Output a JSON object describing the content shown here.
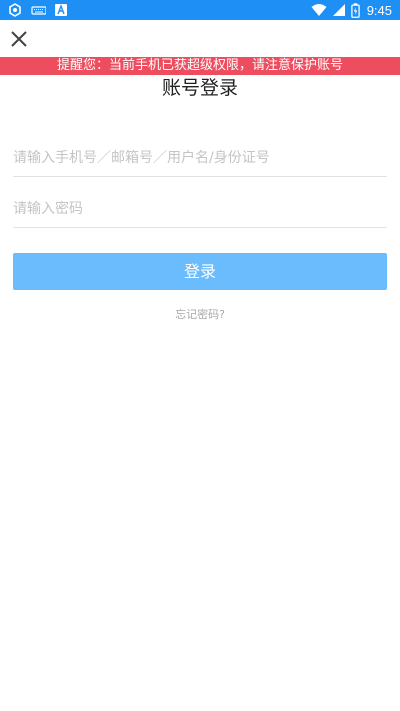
{
  "status_bar": {
    "time": "9:45",
    "left_icons": [
      "app-notification-icon",
      "keyboard-icon",
      "text-input-icon"
    ],
    "right_icons": [
      "wifi-icon",
      "signal-icon",
      "battery-icon"
    ],
    "color": "#1e8ff5"
  },
  "header": {
    "close_icon": "close-icon"
  },
  "warning": {
    "text": "提醒您：当前手机已获超级权限，请注意保护账号",
    "color": "#ee4d5f"
  },
  "login": {
    "title": "账号登录",
    "account_placeholder": "请输入手机号／邮箱号／用户名/身份证号",
    "account_value": "",
    "password_placeholder": "请输入密码",
    "password_value": "",
    "submit_label": "登录",
    "submit_color": "#6bbcfc",
    "forgot_label": "忘记密码?"
  }
}
